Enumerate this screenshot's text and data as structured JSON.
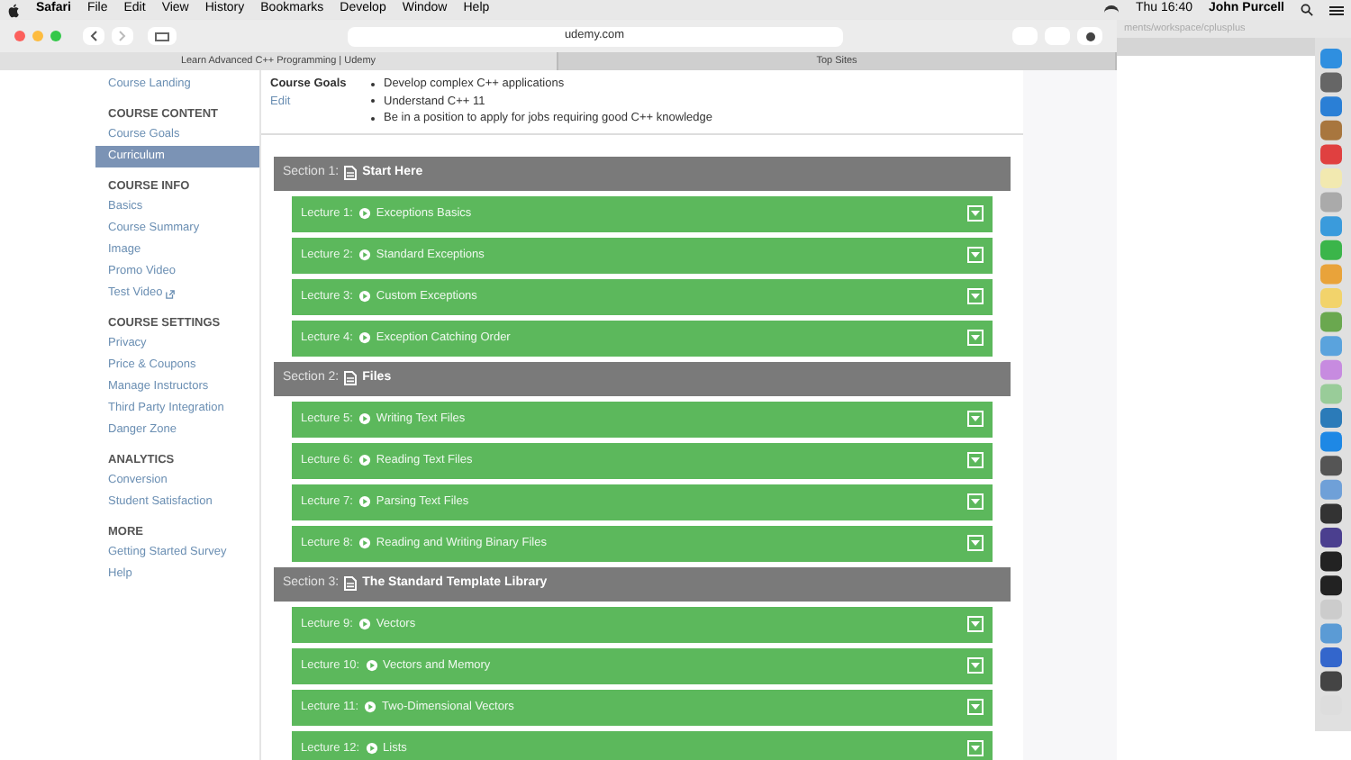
{
  "menu_bar": {
    "app": "Safari",
    "menus": [
      "File",
      "Edit",
      "View",
      "History",
      "Bookmarks",
      "Develop",
      "Window",
      "Help"
    ],
    "clock": "Thu 16:40",
    "user": "John Purcell"
  },
  "browser": {
    "address": "udemy.com",
    "tabs": [
      {
        "label": "Learn Advanced C++ Programming | Udemy",
        "selected": true
      },
      {
        "label": "Top Sites",
        "selected": false
      }
    ]
  },
  "background_window": {
    "path": "ments/workspace/cplusplus"
  },
  "sidebar": {
    "top_item": "Course Landing",
    "groups": [
      {
        "heading": "COURSE CONTENT",
        "items": [
          {
            "label": "Course Goals",
            "selected": false,
            "external": false
          },
          {
            "label": "Curriculum",
            "selected": true,
            "external": false
          }
        ]
      },
      {
        "heading": "COURSE INFO",
        "items": [
          {
            "label": "Basics",
            "selected": false,
            "external": false
          },
          {
            "label": "Course Summary",
            "selected": false,
            "external": false
          },
          {
            "label": "Image",
            "selected": false,
            "external": false
          },
          {
            "label": "Promo Video",
            "selected": false,
            "external": false
          },
          {
            "label": "Test Video",
            "selected": false,
            "external": true
          }
        ]
      },
      {
        "heading": "COURSE SETTINGS",
        "items": [
          {
            "label": "Privacy",
            "selected": false,
            "external": false
          },
          {
            "label": "Price & Coupons",
            "selected": false,
            "external": false
          },
          {
            "label": "Manage Instructors",
            "selected": false,
            "external": false
          },
          {
            "label": "Third Party Integration",
            "selected": false,
            "external": false
          },
          {
            "label": "Danger Zone",
            "selected": false,
            "external": false
          }
        ]
      },
      {
        "heading": "ANALYTICS",
        "items": [
          {
            "label": "Conversion",
            "selected": false,
            "external": false
          },
          {
            "label": "Student Satisfaction",
            "selected": false,
            "external": false
          }
        ]
      },
      {
        "heading": "MORE",
        "items": [
          {
            "label": "Getting Started Survey",
            "selected": false,
            "external": false
          },
          {
            "label": "Help",
            "selected": false,
            "external": false
          }
        ]
      }
    ]
  },
  "goals": {
    "label": "Course Goals",
    "edit": "Edit",
    "items": [
      "Develop complex C++ applications",
      "Understand C++ 11",
      "Be in a position to apply for jobs requiring good C++ knowledge"
    ]
  },
  "sections": [
    {
      "label": "Section 1:",
      "title": "Start Here",
      "lectures": [
        {
          "label": "Lecture 1:",
          "title": "Exceptions Basics"
        },
        {
          "label": "Lecture 2:",
          "title": "Standard Exceptions"
        },
        {
          "label": "Lecture 3:",
          "title": "Custom Exceptions"
        },
        {
          "label": "Lecture 4:",
          "title": "Exception Catching Order"
        }
      ]
    },
    {
      "label": "Section 2:",
      "title": "Files",
      "lectures": [
        {
          "label": "Lecture 5:",
          "title": "Writing Text Files"
        },
        {
          "label": "Lecture 6:",
          "title": "Reading Text Files"
        },
        {
          "label": "Lecture 7:",
          "title": "Parsing Text Files"
        },
        {
          "label": "Lecture 8:",
          "title": "Reading and Writing Binary Files"
        }
      ]
    },
    {
      "label": "Section 3:",
      "title": "The Standard Template Library",
      "lectures": [
        {
          "label": "Lecture 9:",
          "title": "Vectors"
        },
        {
          "label": "Lecture 10:",
          "title": "Vectors and Memory"
        },
        {
          "label": "Lecture 11:",
          "title": "Two-Dimensional Vectors"
        },
        {
          "label": "Lecture 12:",
          "title": "Lists"
        }
      ]
    }
  ]
}
